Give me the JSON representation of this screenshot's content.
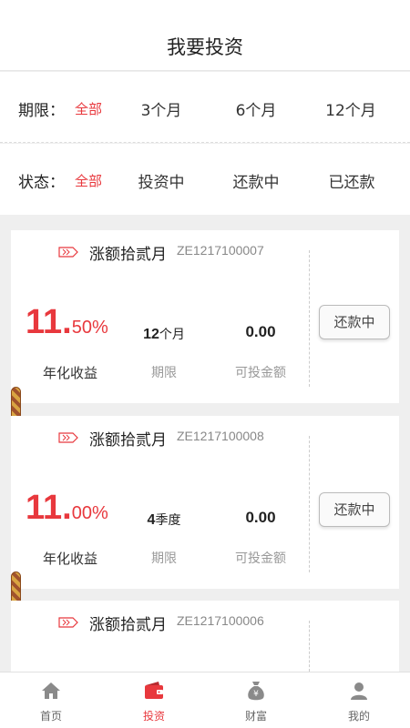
{
  "header": {
    "title": "我要投资"
  },
  "filters": {
    "period": {
      "label": "期限：",
      "options": [
        "全部",
        "3个月",
        "6个月",
        "12个月"
      ],
      "selected": "全部"
    },
    "status": {
      "label": "状态：",
      "options": [
        "全部",
        "投资中",
        "还款中",
        "已还款"
      ],
      "selected": "全部"
    }
  },
  "products": [
    {
      "name": "涨额拾贰月",
      "code": "ZE1217100007",
      "rate_int": "11.",
      "rate_dec": "50%",
      "rate_label": "年化收益",
      "term_num": "12",
      "term_unit": "个月",
      "term_label": "期限",
      "amount": "0.00",
      "amount_label": "可投金额",
      "status": "还款中"
    },
    {
      "name": "涨额拾贰月",
      "code": "ZE1217100008",
      "rate_int": "11.",
      "rate_dec": "00%",
      "rate_label": "年化收益",
      "term_num": "4",
      "term_unit": "季度",
      "term_label": "期限",
      "amount": "0.00",
      "amount_label": "可投金额",
      "status": "还款中"
    },
    {
      "name": "涨额拾贰月",
      "code": "ZE1217100006"
    }
  ],
  "tabbar": {
    "items": [
      {
        "label": "首页",
        "icon": "home-icon"
      },
      {
        "label": "投资",
        "icon": "wallet-icon"
      },
      {
        "label": "财富",
        "icon": "money-bag-icon"
      },
      {
        "label": "我的",
        "icon": "user-icon"
      }
    ],
    "active": "投资"
  },
  "colors": {
    "accent": "#e8383d",
    "background": "#efefef"
  }
}
